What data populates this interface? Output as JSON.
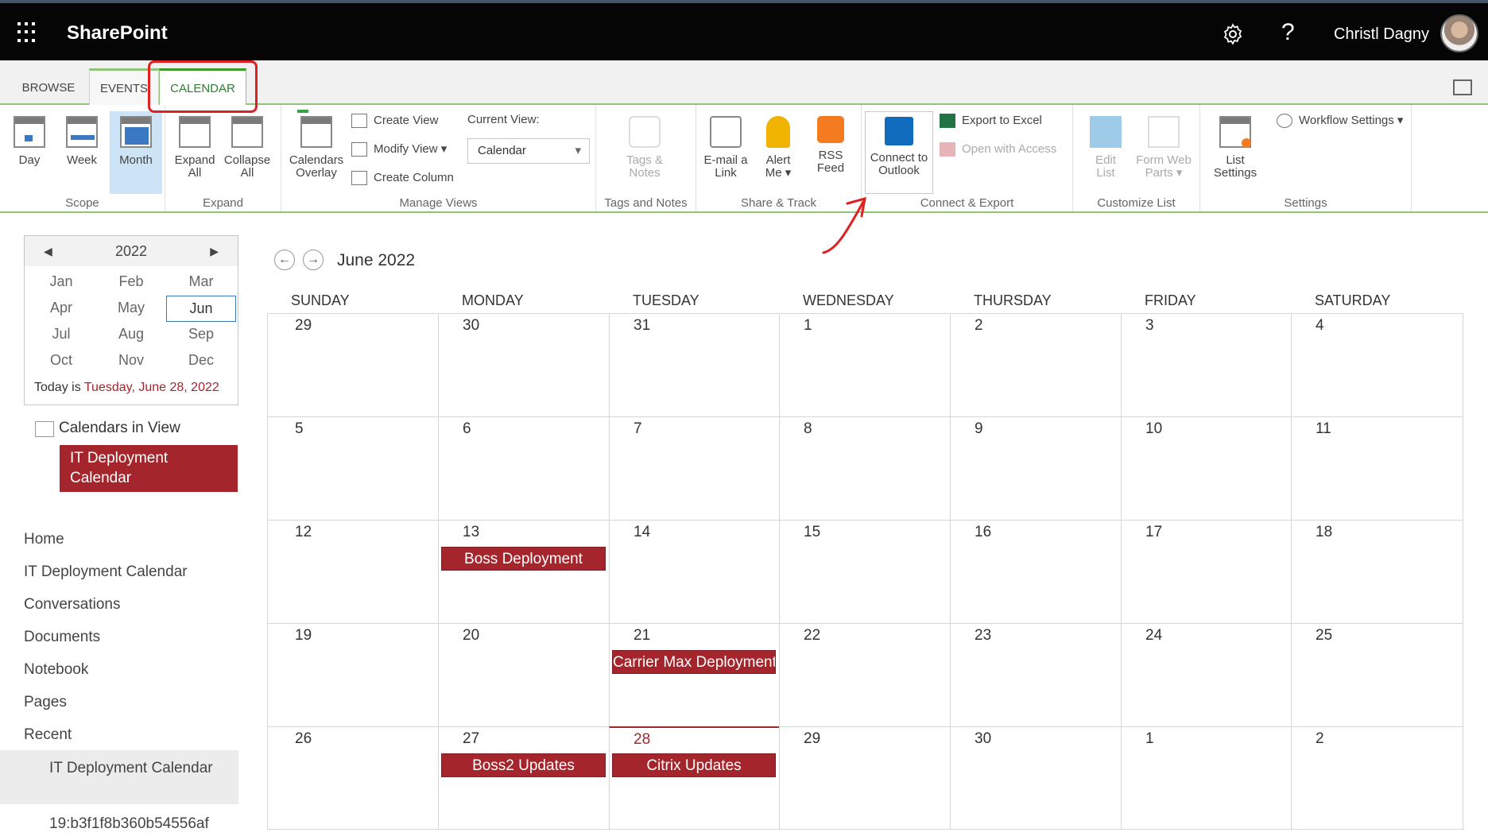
{
  "suite": {
    "brand": "SharePoint",
    "user": "Christl Dagny",
    "help": "?"
  },
  "tabs": [
    {
      "label": "BROWSE"
    },
    {
      "label": "EVENTS"
    },
    {
      "label": "CALENDAR"
    }
  ],
  "ribbon": {
    "scope": {
      "label": "Scope",
      "day": "Day",
      "week": "Week",
      "month": "Month"
    },
    "expand": {
      "label": "Expand",
      "expand_all_1": "Expand",
      "expand_all_2": "All",
      "collapse_all_1": "Collapse",
      "collapse_all_2": "All"
    },
    "manage": {
      "label": "Manage Views",
      "calendars_overlay_1": "Calendars",
      "calendars_overlay_2": "Overlay",
      "create_view": "Create View",
      "modify_view": "Modify View",
      "create_column": "Create Column",
      "current_view_label": "Current View:",
      "current_view": "Calendar"
    },
    "tags": {
      "label": "Tags and Notes",
      "btn_1": "Tags &",
      "btn_2": "Notes"
    },
    "share": {
      "label": "Share & Track",
      "email_1": "E-mail a",
      "email_2": "Link",
      "alert_1": "Alert",
      "alert_2": "Me",
      "rss_1": "RSS",
      "rss_2": "Feed"
    },
    "connect": {
      "label": "Connect & Export",
      "outlook_1": "Connect to",
      "outlook_2": "Outlook",
      "excel": "Export to Excel",
      "access": "Open with Access"
    },
    "customize": {
      "label": "Customize List",
      "edit_1": "Edit",
      "edit_2": "List",
      "webparts_1": "Form Web",
      "webparts_2": "Parts"
    },
    "settings": {
      "label": "Settings",
      "list_1": "List",
      "list_2": "Settings",
      "workflow": "Workflow Settings"
    }
  },
  "datepicker": {
    "year": "2022",
    "months": [
      "Jan",
      "Feb",
      "Mar",
      "Apr",
      "May",
      "Jun",
      "Jul",
      "Aug",
      "Sep",
      "Oct",
      "Nov",
      "Dec"
    ],
    "selected": "Jun",
    "today_prefix": "Today is ",
    "today_date": "Tuesday, June 28, 2022"
  },
  "calendars_in_view": {
    "title": "Calendars in View",
    "item": "IT Deployment Calendar"
  },
  "nav": {
    "items": [
      "Home",
      "IT Deployment Calendar",
      "Conversations",
      "Documents",
      "Notebook",
      "Pages",
      "Recent"
    ],
    "recent_sub": "IT Deployment Calendar",
    "recent_hash": "19:b3f1f8b360b54556af"
  },
  "calendar": {
    "title": "June 2022",
    "days": [
      "SUNDAY",
      "MONDAY",
      "TUESDAY",
      "WEDNESDAY",
      "THURSDAY",
      "FRIDAY",
      "SATURDAY"
    ],
    "weeks": [
      [
        "29",
        "30",
        "31",
        "1",
        "2",
        "3",
        "4"
      ],
      [
        "5",
        "6",
        "7",
        "8",
        "9",
        "10",
        "11"
      ],
      [
        "12",
        "13",
        "14",
        "15",
        "16",
        "17",
        "18"
      ],
      [
        "19",
        "20",
        "21",
        "22",
        "23",
        "24",
        "25"
      ],
      [
        "26",
        "27",
        "28",
        "29",
        "30",
        "1",
        "2"
      ]
    ],
    "today": {
      "week": 4,
      "day": 2
    },
    "events": [
      {
        "title": "Boss Deployment",
        "week": 2,
        "day": 1
      },
      {
        "title": "Carrier Max Deployment",
        "week": 3,
        "day": 2
      },
      {
        "title": "Boss2 Updates",
        "week": 4,
        "day": 1
      },
      {
        "title": "Citrix Updates",
        "week": 4,
        "day": 2
      }
    ]
  },
  "colors": {
    "accent": "#a4262c",
    "ribbon_green": "#8fc47a",
    "annotation": "#e02020"
  }
}
